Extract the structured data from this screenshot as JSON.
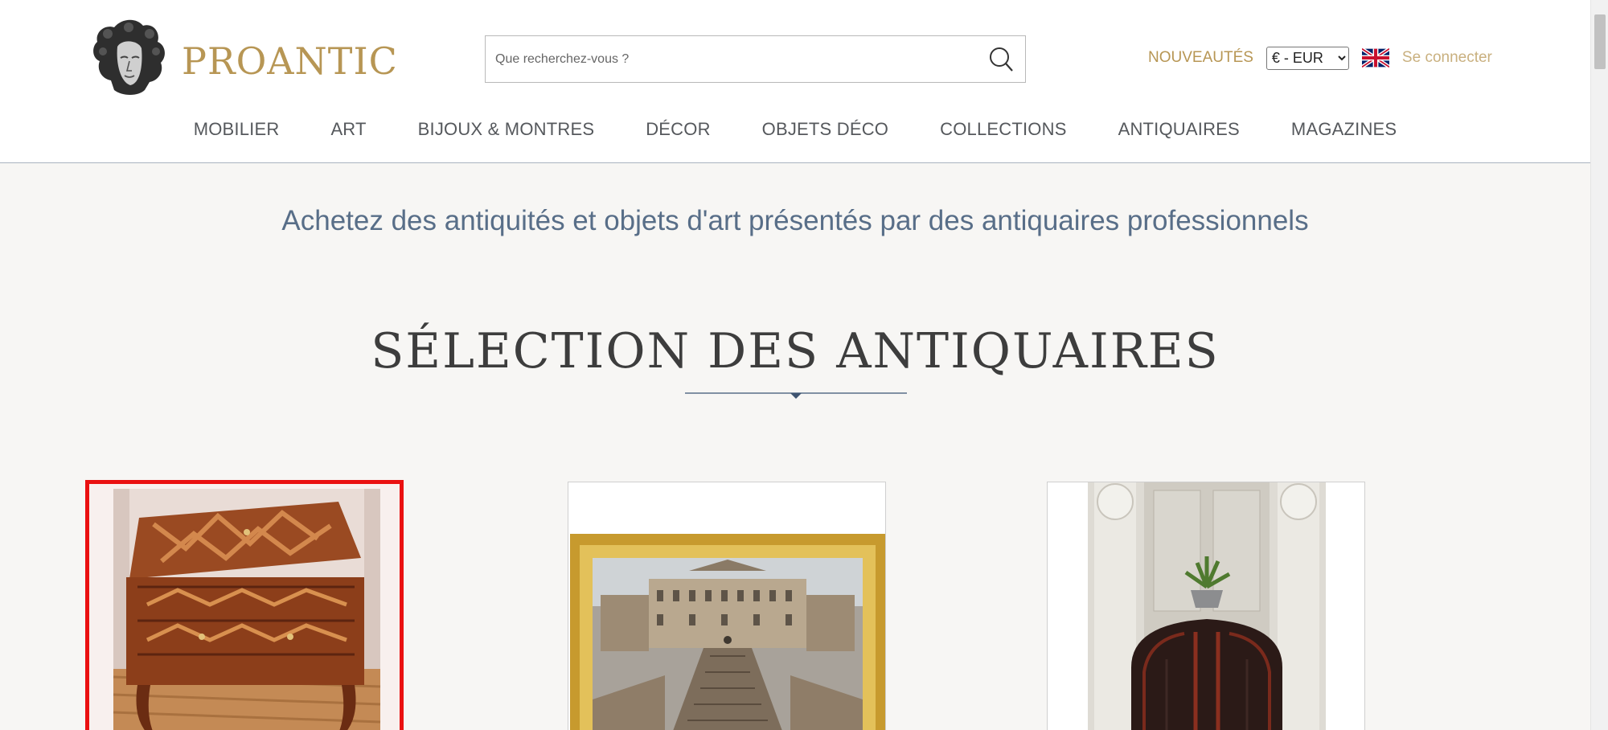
{
  "brand": {
    "name": "PROANTIC"
  },
  "search": {
    "placeholder": "Que recherchez-vous ?"
  },
  "header_links": {
    "nouveautes": "NOUVEAUTÉS",
    "connect": "Se connecter"
  },
  "currency": {
    "selected": "€ - EUR"
  },
  "nav": [
    {
      "label": "MOBILIER"
    },
    {
      "label": "ART"
    },
    {
      "label": "BIJOUX & MONTRES"
    },
    {
      "label": "DÉCOR"
    },
    {
      "label": "OBJETS DÉCO"
    },
    {
      "label": "COLLECTIONS"
    },
    {
      "label": "ANTIQUAIRES"
    },
    {
      "label": "MAGAZINES"
    }
  ],
  "tagline": "Achetez des antiquités et objets d'art présentés par des antiquaires professionnels",
  "section_title": "SÉLECTION DES ANTIQUAIRES",
  "products": [
    {
      "image": "marquetry-slant-front-desk",
      "selected": true
    },
    {
      "image": "gilt-framed-architectural-painting",
      "selected": false
    },
    {
      "image": "velvet-borne-sofa-with-plant",
      "selected": false
    }
  ],
  "colors": {
    "gold": "#b79654",
    "nav_text": "#55585c",
    "tagline": "#586e88",
    "selection_border": "#ea1010"
  }
}
